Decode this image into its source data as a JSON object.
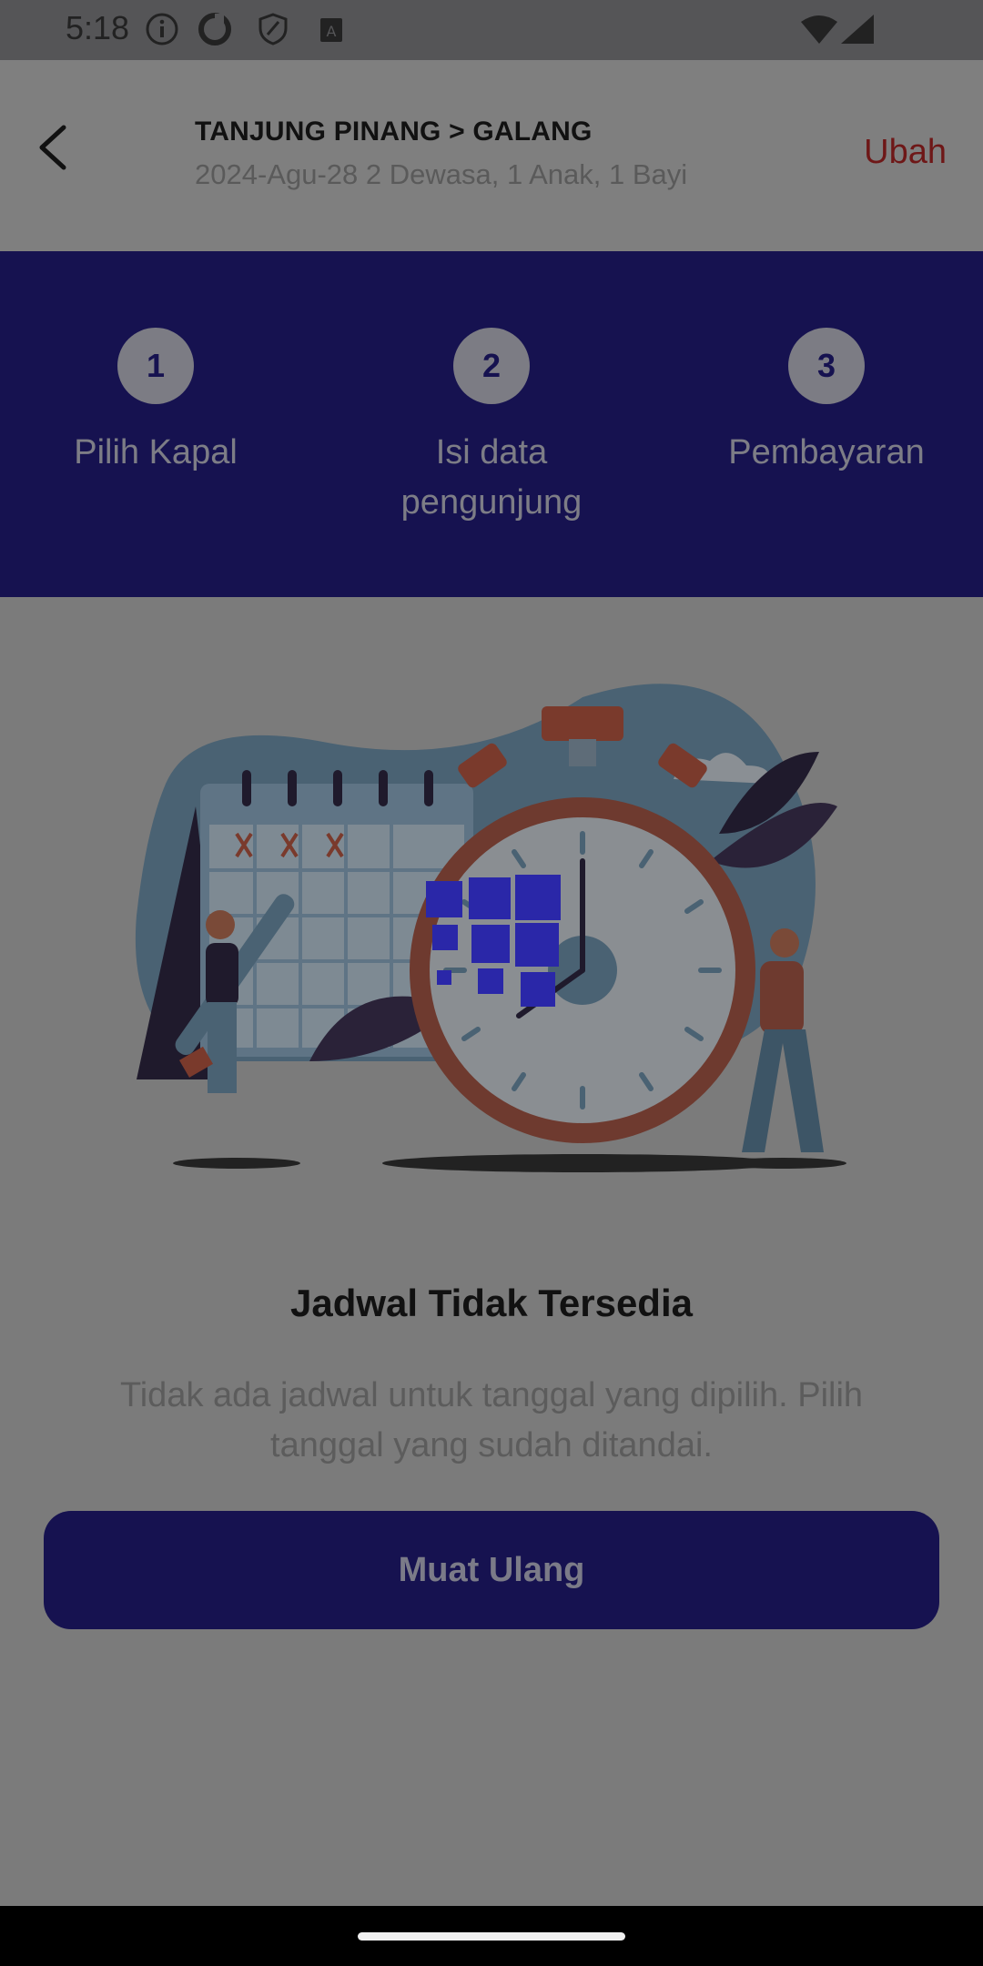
{
  "status_bar": {
    "time": "5:18",
    "icons": [
      "info-icon",
      "sync-icon",
      "shield-icon",
      "a-icon",
      "wifi-icon",
      "signal-icon"
    ]
  },
  "header": {
    "route": "TANJUNG PINANG > GALANG",
    "meta": "2024-Agu-28 2 Dewasa, 1 Anak, 1 Bayi",
    "change_label": "Ubah",
    "back_icon": "chevron-left-icon"
  },
  "stepper": {
    "steps": [
      {
        "number": "1",
        "label": "Pilih Kapal"
      },
      {
        "number": "2",
        "label": "Isi data pengunjung"
      },
      {
        "number": "3",
        "label": "Pembayaran"
      }
    ]
  },
  "empty_state": {
    "title": "Jadwal Tidak Tersedia",
    "message": "Tidak ada jadwal untuk tanggal yang dipilih. Pilih tanggal yang sudah ditandai.",
    "button_label": "Muat Ulang"
  },
  "colors": {
    "primary": "#161250",
    "accent": "#6e1717",
    "overlay": "#7b7b7b"
  }
}
